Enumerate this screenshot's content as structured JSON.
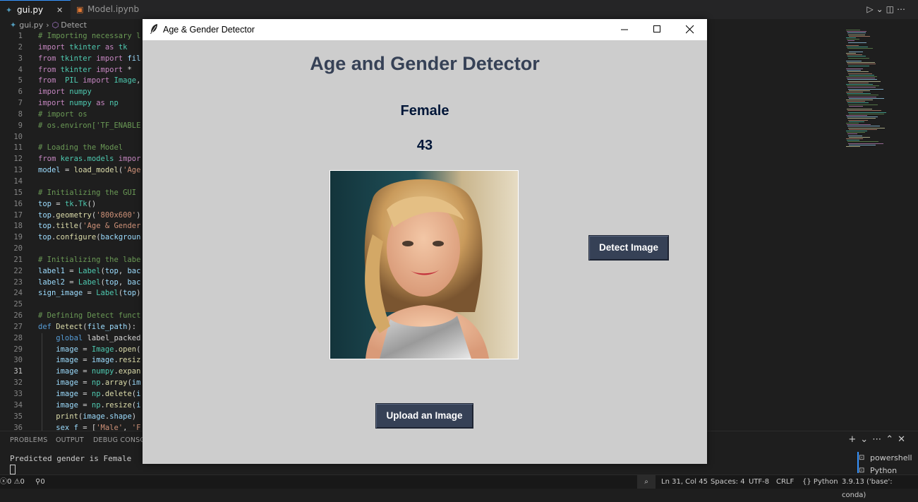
{
  "editor": {
    "tabs": [
      {
        "label": "gui.py",
        "close": "✕"
      },
      {
        "label": "Model.ipynb"
      }
    ],
    "breadcrumb": {
      "file": "gui.py",
      "symbol": "Detect"
    },
    "code_lines": [
      {
        "n": "1",
        "segs": [
          [
            "c-comment",
            "# Importing necessary l"
          ]
        ]
      },
      {
        "n": "2",
        "segs": [
          [
            "c-kw",
            "import "
          ],
          [
            "c-cls",
            "tkinter "
          ],
          [
            "c-kw",
            "as "
          ],
          [
            "c-cls",
            "tk"
          ]
        ]
      },
      {
        "n": "3",
        "segs": [
          [
            "c-kw",
            "from "
          ],
          [
            "c-cls",
            "tkinter "
          ],
          [
            "c-kw",
            "import "
          ],
          [
            "c-var",
            "fil"
          ]
        ]
      },
      {
        "n": "4",
        "segs": [
          [
            "c-kw",
            "from "
          ],
          [
            "c-cls",
            "tkinter "
          ],
          [
            "c-kw",
            "import "
          ],
          [
            "c-plain",
            "*"
          ]
        ]
      },
      {
        "n": "5",
        "segs": [
          [
            "c-kw",
            "from  "
          ],
          [
            "c-cls",
            "PIL "
          ],
          [
            "c-kw",
            "import "
          ],
          [
            "c-cls",
            "Image"
          ],
          [
            "c-plain",
            ","
          ]
        ]
      },
      {
        "n": "6",
        "segs": [
          [
            "c-kw",
            "import "
          ],
          [
            "c-cls",
            "numpy"
          ]
        ]
      },
      {
        "n": "7",
        "segs": [
          [
            "c-kw",
            "import "
          ],
          [
            "c-cls",
            "numpy "
          ],
          [
            "c-kw",
            "as "
          ],
          [
            "c-cls",
            "np"
          ]
        ]
      },
      {
        "n": "8",
        "segs": [
          [
            "c-comment",
            "# import os"
          ]
        ]
      },
      {
        "n": "9",
        "segs": [
          [
            "c-comment",
            "# os.environ['TF_ENABLE"
          ]
        ]
      },
      {
        "n": "10",
        "segs": []
      },
      {
        "n": "11",
        "segs": [
          [
            "c-comment",
            "# Loading the Model"
          ]
        ]
      },
      {
        "n": "12",
        "segs": [
          [
            "c-kw",
            "from "
          ],
          [
            "c-cls",
            "keras.models "
          ],
          [
            "c-kw",
            "impor"
          ]
        ]
      },
      {
        "n": "13",
        "segs": [
          [
            "c-var",
            "model "
          ],
          [
            "c-plain",
            "= "
          ],
          [
            "c-fn",
            "load_model"
          ],
          [
            "c-plain",
            "("
          ],
          [
            "c-str",
            "'Age"
          ]
        ]
      },
      {
        "n": "14",
        "segs": []
      },
      {
        "n": "15",
        "segs": [
          [
            "c-comment",
            "# Initializing the GUI"
          ]
        ]
      },
      {
        "n": "16",
        "segs": [
          [
            "c-var",
            "top "
          ],
          [
            "c-plain",
            "= "
          ],
          [
            "c-cls",
            "tk"
          ],
          [
            "c-plain",
            "."
          ],
          [
            "c-cls",
            "Tk"
          ],
          [
            "c-plain",
            "()"
          ]
        ]
      },
      {
        "n": "17",
        "segs": [
          [
            "c-var",
            "top"
          ],
          [
            "c-plain",
            "."
          ],
          [
            "c-fn",
            "geometry"
          ],
          [
            "c-plain",
            "("
          ],
          [
            "c-str",
            "'800x600'"
          ],
          [
            "c-plain",
            ")"
          ]
        ]
      },
      {
        "n": "18",
        "segs": [
          [
            "c-var",
            "top"
          ],
          [
            "c-plain",
            "."
          ],
          [
            "c-fn",
            "title"
          ],
          [
            "c-plain",
            "("
          ],
          [
            "c-str",
            "'Age & Gender"
          ]
        ]
      },
      {
        "n": "19",
        "segs": [
          [
            "c-var",
            "top"
          ],
          [
            "c-plain",
            "."
          ],
          [
            "c-fn",
            "configure"
          ],
          [
            "c-plain",
            "("
          ],
          [
            "c-var",
            "backgroun"
          ]
        ]
      },
      {
        "n": "20",
        "segs": []
      },
      {
        "n": "21",
        "segs": [
          [
            "c-comment",
            "# Initializing the labe"
          ]
        ]
      },
      {
        "n": "22",
        "segs": [
          [
            "c-var",
            "label1 "
          ],
          [
            "c-plain",
            "= "
          ],
          [
            "c-cls",
            "Label"
          ],
          [
            "c-plain",
            "("
          ],
          [
            "c-var",
            "top"
          ],
          [
            "c-plain",
            ", "
          ],
          [
            "c-var",
            "bac"
          ]
        ]
      },
      {
        "n": "23",
        "segs": [
          [
            "c-var",
            "label2 "
          ],
          [
            "c-plain",
            "= "
          ],
          [
            "c-cls",
            "Label"
          ],
          [
            "c-plain",
            "("
          ],
          [
            "c-var",
            "top"
          ],
          [
            "c-plain",
            ", "
          ],
          [
            "c-var",
            "bac"
          ]
        ]
      },
      {
        "n": "24",
        "segs": [
          [
            "c-var",
            "sign_image "
          ],
          [
            "c-plain",
            "= "
          ],
          [
            "c-cls",
            "Label"
          ],
          [
            "c-plain",
            "("
          ],
          [
            "c-var",
            "top"
          ],
          [
            "c-plain",
            ")"
          ]
        ]
      },
      {
        "n": "25",
        "segs": []
      },
      {
        "n": "26",
        "segs": [
          [
            "c-comment",
            "# Defining Detect funct"
          ]
        ]
      },
      {
        "n": "27",
        "segs": [
          [
            "c-def",
            "def "
          ],
          [
            "c-fn",
            "Detect"
          ],
          [
            "c-plain",
            "("
          ],
          [
            "c-var",
            "file_path"
          ],
          [
            "c-plain",
            "):"
          ]
        ]
      },
      {
        "n": "28",
        "segs": [
          [
            "c-def",
            "    global "
          ],
          [
            "c-plain",
            "label_packed"
          ]
        ]
      },
      {
        "n": "29",
        "segs": [
          [
            "c-var",
            "    image "
          ],
          [
            "c-plain",
            "= "
          ],
          [
            "c-cls",
            "Image"
          ],
          [
            "c-plain",
            "."
          ],
          [
            "c-fn",
            "open"
          ],
          [
            "c-plain",
            "("
          ]
        ]
      },
      {
        "n": "30",
        "segs": [
          [
            "c-var",
            "    image "
          ],
          [
            "c-plain",
            "= "
          ],
          [
            "c-var",
            "image"
          ],
          [
            "c-plain",
            "."
          ],
          [
            "c-fn",
            "resiz"
          ]
        ]
      },
      {
        "n": "31",
        "segs": [
          [
            "c-var",
            "    image "
          ],
          [
            "c-plain",
            "= "
          ],
          [
            "c-cls",
            "numpy"
          ],
          [
            "c-plain",
            "."
          ],
          [
            "c-fn",
            "expan"
          ]
        ],
        "current": true
      },
      {
        "n": "32",
        "segs": [
          [
            "c-var",
            "    image "
          ],
          [
            "c-plain",
            "= "
          ],
          [
            "c-cls",
            "np"
          ],
          [
            "c-plain",
            "."
          ],
          [
            "c-fn",
            "array"
          ],
          [
            "c-plain",
            "("
          ],
          [
            "c-var",
            "im"
          ]
        ]
      },
      {
        "n": "33",
        "segs": [
          [
            "c-var",
            "    image "
          ],
          [
            "c-plain",
            "= "
          ],
          [
            "c-cls",
            "np"
          ],
          [
            "c-plain",
            "."
          ],
          [
            "c-fn",
            "delete"
          ],
          [
            "c-plain",
            "("
          ],
          [
            "c-var",
            "i"
          ]
        ]
      },
      {
        "n": "34",
        "segs": [
          [
            "c-var",
            "    image "
          ],
          [
            "c-plain",
            "= "
          ],
          [
            "c-cls",
            "np"
          ],
          [
            "c-plain",
            "."
          ],
          [
            "c-fn",
            "resize"
          ],
          [
            "c-plain",
            "("
          ],
          [
            "c-var",
            "i"
          ]
        ]
      },
      {
        "n": "35",
        "segs": [
          [
            "c-fn",
            "    print"
          ],
          [
            "c-plain",
            "("
          ],
          [
            "c-var",
            "image"
          ],
          [
            "c-plain",
            "."
          ],
          [
            "c-var",
            "shape"
          ],
          [
            "c-plain",
            ")"
          ]
        ]
      },
      {
        "n": "36",
        "segs": [
          [
            "c-var",
            "    sex_f "
          ],
          [
            "c-plain",
            "= ["
          ],
          [
            "c-str",
            "'Male'"
          ],
          [
            "c-plain",
            ", "
          ],
          [
            "c-str",
            "'F"
          ]
        ]
      }
    ]
  },
  "panel": {
    "tabs": [
      "PROBLEMS",
      "OUTPUT",
      "DEBUG CONSOLE"
    ],
    "terminal_output": "Predicted gender is Female",
    "terminals": [
      "powershell",
      "Python"
    ]
  },
  "statusbar": {
    "errors": "0",
    "warnings": "0",
    "ports": "0",
    "position": "Ln 31, Col 45",
    "spaces": "Spaces: 4",
    "encoding": "UTF-8",
    "eol": "CRLF",
    "language": "Python",
    "interpreter": "3.9.13 ('base': conda)"
  },
  "app": {
    "window_title": "Age & Gender Detector",
    "heading": "Age and Gender Detector",
    "gender_result": "Female",
    "age_result": "43",
    "detect_button": "Detect Image",
    "upload_button": "Upload an Image",
    "colors": {
      "background": "#cdcdcd",
      "heading": "#364156",
      "result_text": "#011638",
      "button_bg": "#364156",
      "button_fg": "#ffffff"
    }
  }
}
